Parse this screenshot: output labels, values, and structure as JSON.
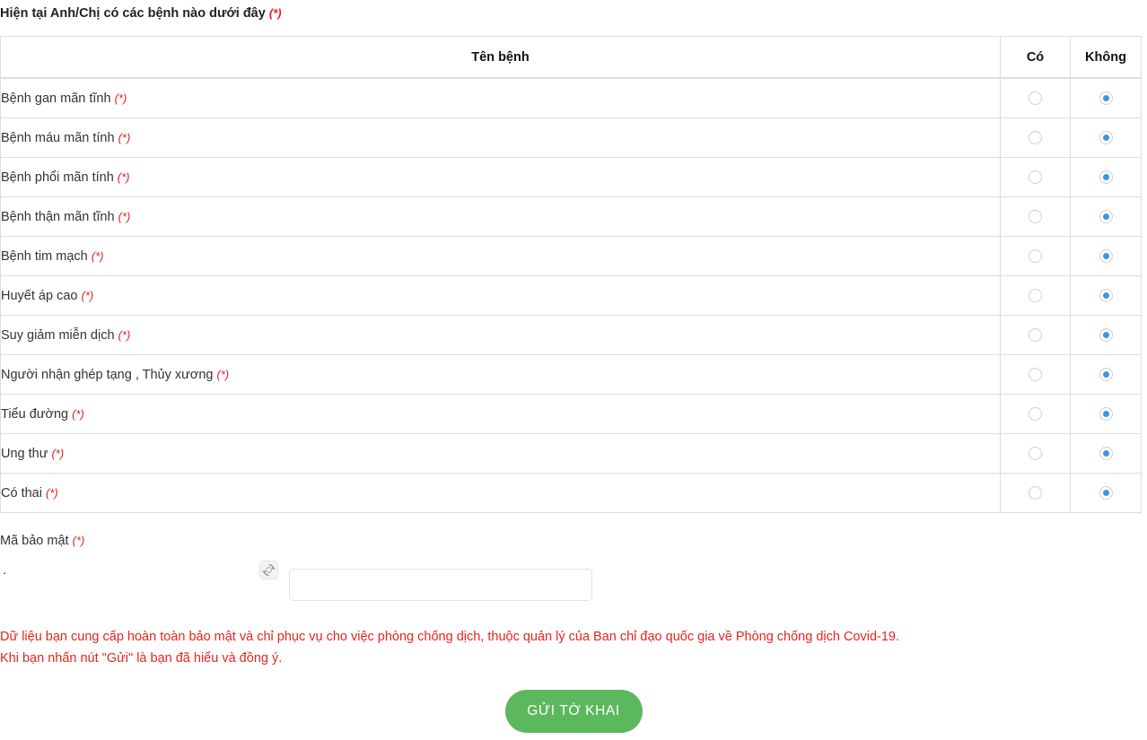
{
  "section": {
    "heading": "Hiện tại Anh/Chị có các bệnh nào dưới đây",
    "required_marker": "(*)"
  },
  "table": {
    "headers": {
      "name": "Tên bệnh",
      "yes": "Có",
      "no": "Không"
    },
    "rows": [
      {
        "label": "Bệnh gan mãn tĩnh",
        "required_marker": "(*)",
        "yes_checked": false,
        "no_checked": true
      },
      {
        "label": "Bệnh máu mãn tính",
        "required_marker": "(*)",
        "yes_checked": false,
        "no_checked": true
      },
      {
        "label": "Bệnh phổi mãn tính",
        "required_marker": "(*)",
        "yes_checked": false,
        "no_checked": true
      },
      {
        "label": "Bệnh thận mãn tĩnh",
        "required_marker": "(*)",
        "yes_checked": false,
        "no_checked": true
      },
      {
        "label": "Bệnh tim mạch",
        "required_marker": "(*)",
        "yes_checked": false,
        "no_checked": true
      },
      {
        "label": "Huyết áp cao",
        "required_marker": "(*)",
        "yes_checked": false,
        "no_checked": true
      },
      {
        "label": "Suy giảm miễn dịch",
        "required_marker": "(*)",
        "yes_checked": false,
        "no_checked": true
      },
      {
        "label": "Người nhận ghép tạng , Thủy xương",
        "required_marker": "(*)",
        "yes_checked": false,
        "no_checked": true
      },
      {
        "label": "Tiểu đường",
        "required_marker": "(*)",
        "yes_checked": false,
        "no_checked": true
      },
      {
        "label": "Ung thư",
        "required_marker": "(*)",
        "yes_checked": false,
        "no_checked": true
      },
      {
        "label": "Có thai",
        "required_marker": "(*)",
        "yes_checked": false,
        "no_checked": true
      }
    ]
  },
  "captcha": {
    "label": "Mã bảo mật",
    "required_marker": "(*)",
    "image_text": ".",
    "refresh_icon": "refresh-icon",
    "input_value": "",
    "input_placeholder": ""
  },
  "notice": {
    "line1": "Dữ liệu bạn cung cấp hoàn toàn bảo mật và chỉ phục vụ cho việc phòng chống dịch, thuộc quản lý của Ban chỉ đạo quốc gia về Phòng chống dịch Covid-19.",
    "line2": "Khi bạn nhấn nút \"Gửi\" là bạn đã hiểu và đồng ý."
  },
  "submit": {
    "label": "GỬI TỜ KHAI"
  },
  "colors": {
    "required": "#e02020",
    "notice": "#e8241c",
    "submit_bg": "#5cb85c",
    "radio_checked": "#3b97e3",
    "table_border": "#dddddd"
  }
}
